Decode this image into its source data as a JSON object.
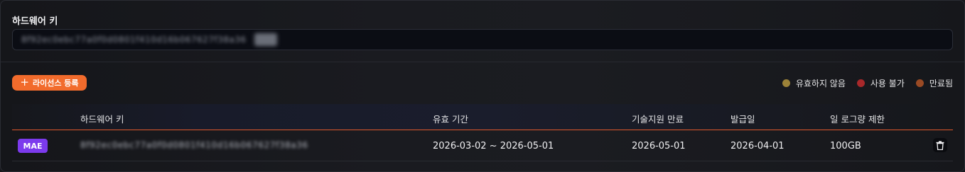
{
  "hardware_key": {
    "label": "하드웨어 키",
    "value": "8f92ec0ebc77a0f0d0801f410d16b067627f38a36"
  },
  "actions": {
    "add_license_label": "라이선스 등록"
  },
  "legend": [
    {
      "label": "유효하지 않음",
      "color": "#9c8238"
    },
    {
      "label": "사용 불가",
      "color": "#a8282a"
    },
    {
      "label": "만료됨",
      "color": "#9a4a24"
    }
  ],
  "table": {
    "headers": [
      "하드웨어 키",
      "유효 기간",
      "기술지원 만료",
      "발급일",
      "일 로그량 제한"
    ],
    "rows": [
      {
        "badge": "MAE",
        "key": "8f92ec0ebc77a0f0d0801f410d16b067627f38a36",
        "validity": "2026-03-02 ~ 2026-05-01",
        "support_expiry": "2026-05-01",
        "issued": "2026-04-01",
        "log_limit": "100GB"
      }
    ]
  },
  "colors": {
    "accent": "#f26b2c",
    "badge": "#7c3aed",
    "header_underline": "#e0582c"
  }
}
